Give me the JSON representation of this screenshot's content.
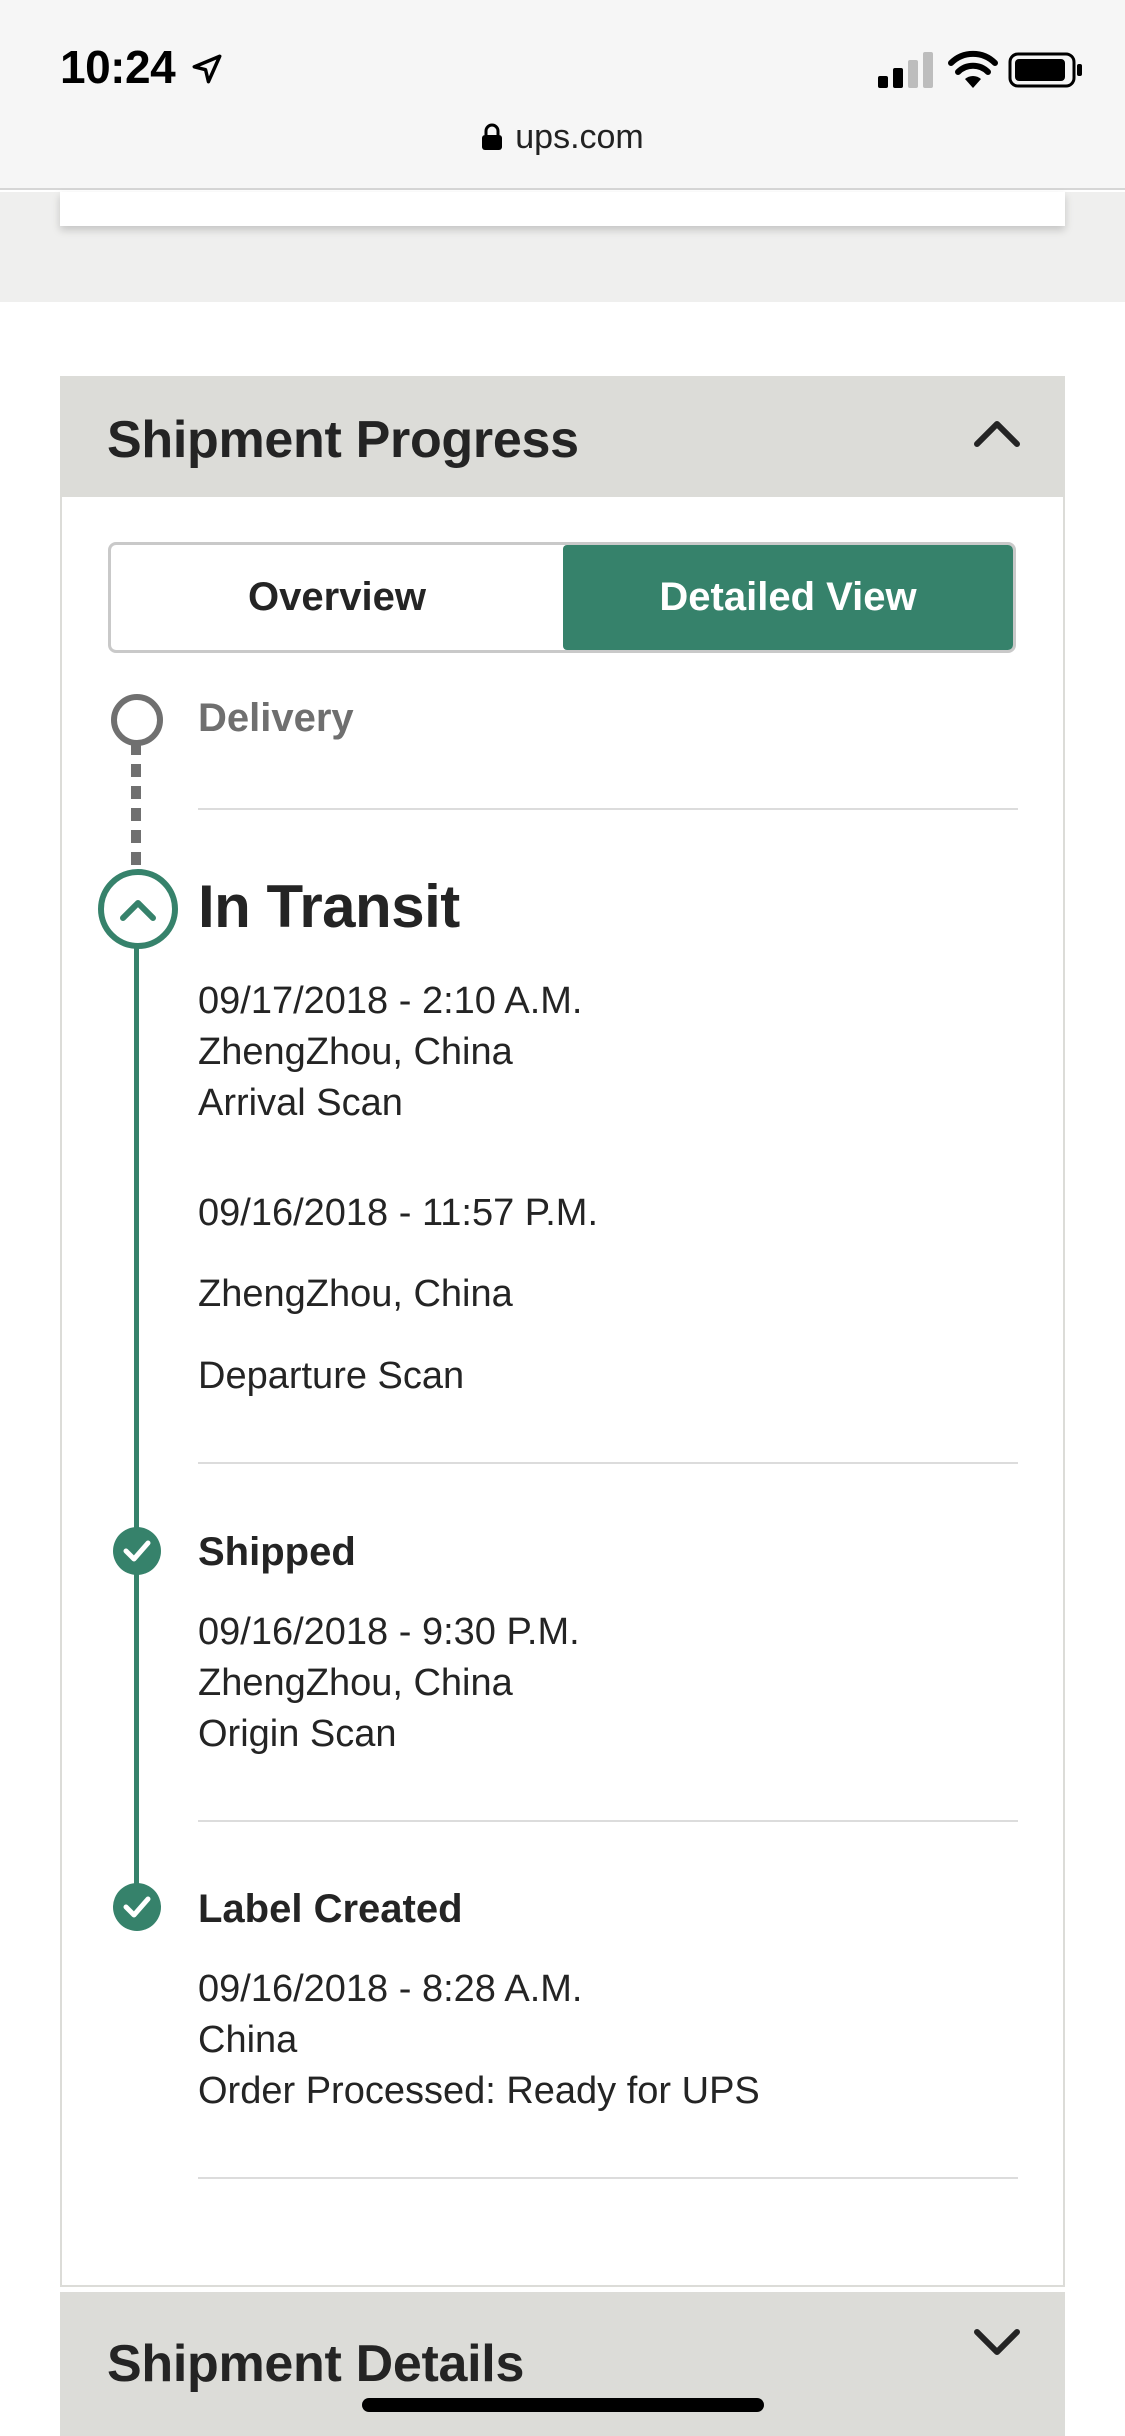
{
  "status_bar": {
    "time": "10:24",
    "url": "ups.com"
  },
  "shipment_progress": {
    "title": "Shipment Progress",
    "toggle": {
      "overview_label": "Overview",
      "detailed_label": "Detailed View",
      "selected": "Detailed View"
    },
    "delivery_label": "Delivery",
    "in_transit": {
      "label": "In Transit",
      "events": [
        {
          "datetime": "09/17/2018 - 2:10 A.M.",
          "location": "ZhengZhou, China",
          "activity": "Arrival Scan"
        },
        {
          "datetime": "09/16/2018 - 11:57 P.M.",
          "location": "ZhengZhou, China",
          "activity": "Departure Scan"
        }
      ]
    },
    "shipped": {
      "label": "Shipped",
      "events": [
        {
          "datetime": "09/16/2018 - 9:30 P.M.",
          "location": "ZhengZhou, China",
          "activity": "Origin Scan"
        }
      ]
    },
    "label_created": {
      "label": "Label Created",
      "events": [
        {
          "datetime": "09/16/2018 - 8:28 A.M.",
          "location": "China",
          "activity": "Order Processed: Ready for UPS"
        }
      ]
    }
  },
  "shipment_details": {
    "title": "Shipment Details"
  },
  "colors": {
    "accent": "#36826b",
    "header_bg": "#dcdcd8",
    "muted": "#6f6f6f"
  }
}
